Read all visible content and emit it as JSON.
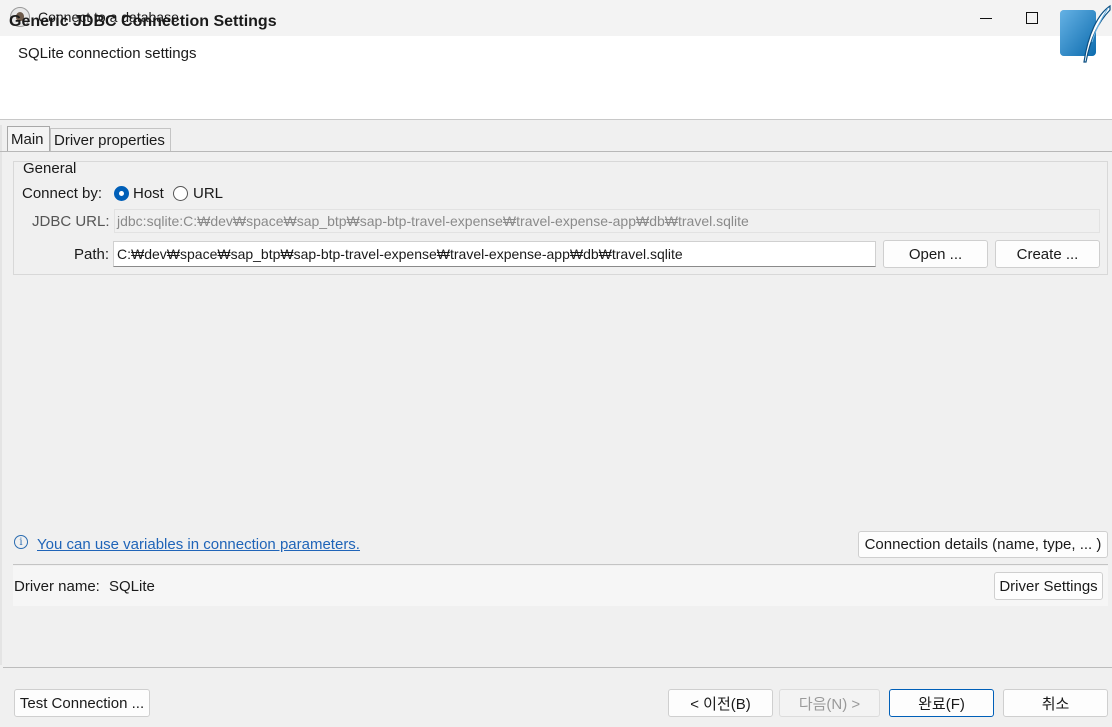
{
  "window": {
    "title": "Connect to a database",
    "controls": {
      "minimize": "minimize-icon",
      "maximize": "maximize-icon",
      "close": "close-icon"
    }
  },
  "header": {
    "title": "Generic JDBC Connection Settings",
    "subtitle": "SQLite connection settings",
    "logo": "sqlite-feather-logo"
  },
  "tabs": [
    {
      "label": "Main",
      "active": true
    },
    {
      "label": "Driver properties",
      "active": false
    }
  ],
  "general": {
    "legend": "General",
    "connect_by_label": "Connect by:",
    "radio_host_label": "Host",
    "radio_url_label": "URL",
    "selected": "Host",
    "jdbc_label": "JDBC URL:",
    "jdbc_value": "jdbc:sqlite:C:₩dev₩space₩sap_btp₩sap-btp-travel-expense₩travel-expense-app₩db₩travel.sqlite",
    "path_label": "Path:",
    "path_value": "C:₩dev₩space₩sap_btp₩sap-btp-travel-expense₩travel-expense-app₩db₩travel.sqlite",
    "open_label": "Open ...",
    "create_label": "Create ..."
  },
  "hint": {
    "icon": "info-icon",
    "link_text": "You can use variables in connection parameters."
  },
  "connection_details_label": "Connection details (name, type, ... )",
  "driver": {
    "name_label": "Driver name:",
    "name_value": "SQLite",
    "settings_label": "Driver Settings"
  },
  "footer": {
    "test_label": "Test Connection ...",
    "back_label": "< 이전(B)",
    "next_label": "다음(N) >",
    "finish_label": "완료(F)",
    "cancel_label": "취소"
  },
  "colors": {
    "accent": "#005fb8",
    "link": "#1f64b8",
    "window_bg": "#f0f0f0",
    "header_bg": "#ffffff"
  }
}
